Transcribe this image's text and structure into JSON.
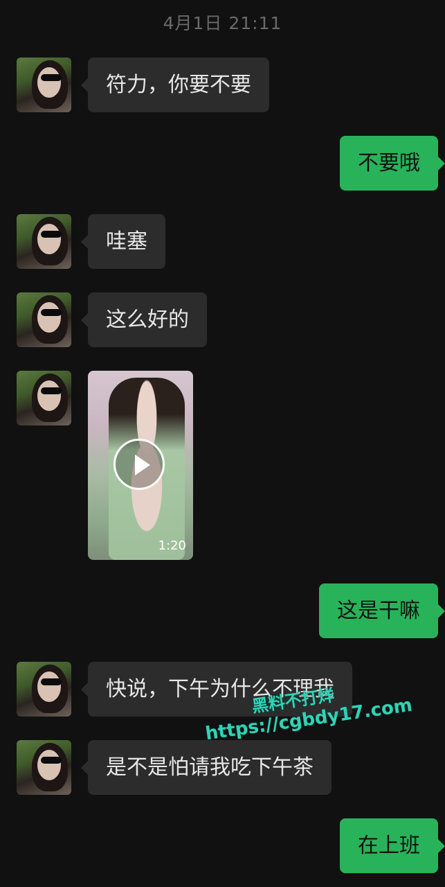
{
  "timestamp": "4月1日 21:11",
  "messages": [
    {
      "side": "left",
      "text": "符力，你要不要"
    },
    {
      "side": "right",
      "text": "不要哦"
    },
    {
      "side": "left",
      "text": "哇塞"
    },
    {
      "side": "left",
      "text": "这么好的"
    },
    {
      "side": "left",
      "type": "video",
      "duration": "1:20"
    },
    {
      "side": "right",
      "text": "这是干嘛"
    },
    {
      "side": "left",
      "text": "快说，下午为什么不理我"
    },
    {
      "side": "left",
      "text": "是不是怕请我吃下午茶"
    },
    {
      "side": "right",
      "text": "在上班"
    }
  ],
  "watermark": {
    "line1": "黑料不打烊",
    "line2": "https://cgbdy17.com"
  },
  "colors": {
    "background": "#111111",
    "incoming_bubble": "#2c2c2c",
    "outgoing_bubble": "#28b35a",
    "watermark": "#2ed3b6"
  }
}
